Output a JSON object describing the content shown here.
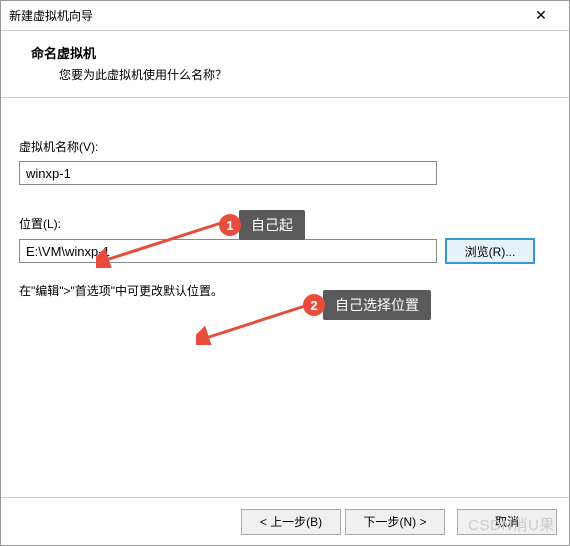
{
  "window": {
    "title": "新建虚拟机向导",
    "close_glyph": "✕"
  },
  "header": {
    "title": "命名虚拟机",
    "subtitle": "您要为此虚拟机使用什么名称？"
  },
  "fields": {
    "name_label": "虚拟机名称(V):",
    "name_value": "winxp-1",
    "location_label": "位置(L):",
    "location_value": "E:\\VM\\winxp-1",
    "browse_label": "浏览(R)..."
  },
  "hint": "在\"编辑\">\"首选项\"中可更改默认位置。",
  "callouts": {
    "c1": {
      "num": "1",
      "label": "自己起"
    },
    "c2": {
      "num": "2",
      "label": "自己选择位置"
    }
  },
  "footer": {
    "back": "< 上一步(B)",
    "next": "下一步(N) >",
    "cancel": "取消"
  },
  "watermark": "CSDN消U果"
}
